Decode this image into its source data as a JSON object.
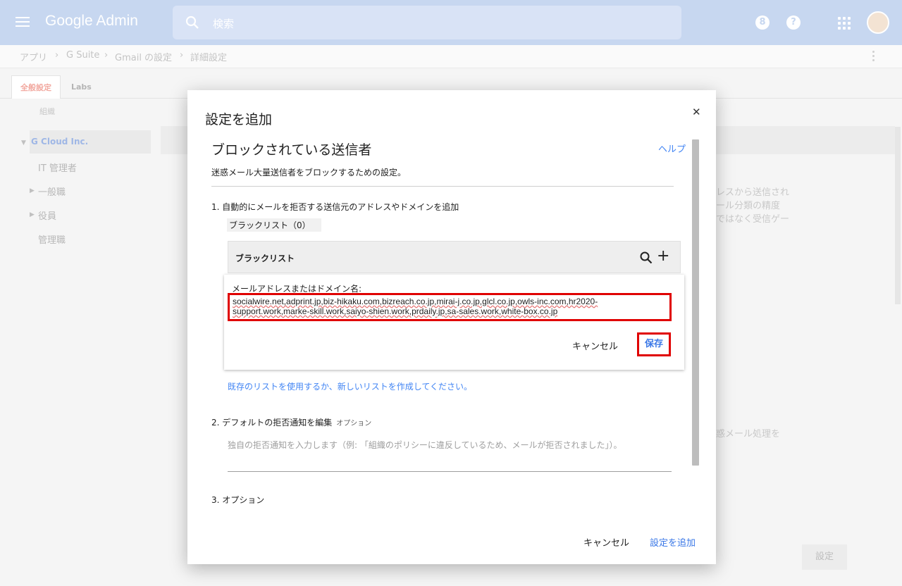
{
  "topbar": {
    "logo": "Google Admin",
    "search_placeholder": "検索",
    "icons": [
      "menu-icon",
      "search-icon",
      "account-8-icon",
      "help-icon",
      "apps-icon",
      "avatar"
    ],
    "colors": {
      "bar": "#c7d7f0",
      "accent": "#4285f4"
    }
  },
  "breadcrumb": [
    "アプリ",
    "G Suite",
    "Gmail の設定",
    "詳細設定"
  ],
  "tabs": [
    "全般設定",
    "Labs"
  ],
  "tree": {
    "header": "組織",
    "items": [
      "G Cloud Inc.",
      "IT 管理者",
      "一般職",
      "役員",
      "管理職"
    ]
  },
  "background": {
    "snippets": [
      "レスから送信され",
      "ール分類の精度",
      "ではなく受信ゲー",
      "惑メール処理を"
    ],
    "button": "設定"
  },
  "dialog": {
    "title": "設定を追加",
    "section_title": "ブロックされている送信者",
    "help": "ヘルプ",
    "description": "迷惑メール大量送信者をブロックするための設定。",
    "step1": "1. 自動的にメールを拒否する送信元のアドレスやドメインを追加",
    "blacklist_label": "ブラックリスト（0）",
    "blacklist_header": "ブラックリスト",
    "edit": {
      "label": "メールアドレスまたはドメイン名:",
      "value_line1": "socialwire.net,adprint.jp,biz-hikaku.com,bizreach.co.jp,mirai-j.co.jp,glcl.co.jp,owls-inc.com,hr2020-",
      "value_line2": "support.work,marke-skill.work,saiyo-shien.work,prdaily.jp,sa-sales.work,white-box.co.jp",
      "cancel": "キャンセル",
      "save": "保存"
    },
    "list_link": "既存のリストを使用するか、新しいリストを作成してください。",
    "step2": "2. デフォルトの拒否通知を編集",
    "step2_option": "オプション",
    "reject_placeholder": "独自の拒否通知を入力します（例: 「組織のポリシーに違反しているため、メールが拒否されました」）。",
    "step3": "3. オプション",
    "footer_cancel": "キャンセル",
    "footer_add": "設定を追加"
  }
}
